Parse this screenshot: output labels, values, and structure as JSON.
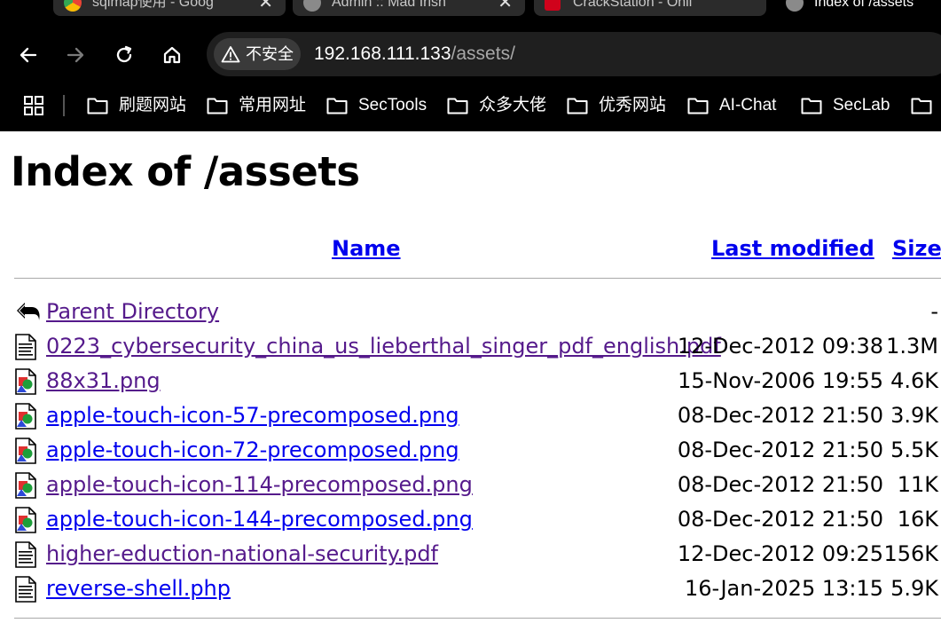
{
  "browser": {
    "tabs": [
      {
        "title": "sqlmap使用 - Goog"
      },
      {
        "title": "Admin :: Mad Irish"
      },
      {
        "title": "CrackStation - Onli"
      },
      {
        "title": "Index of /assets"
      }
    ],
    "security_label": "不安全",
    "url_host": "192.168.111.133",
    "url_path": "/assets/",
    "bookmarks": [
      {
        "label": "刷题网站"
      },
      {
        "label": "常用网址"
      },
      {
        "label": "SecTools"
      },
      {
        "label": "众多大佬"
      },
      {
        "label": "优秀网站"
      },
      {
        "label": "AI-Chat"
      },
      {
        "label": "SecLab"
      }
    ]
  },
  "page": {
    "title": "Index of /assets",
    "columns": {
      "name": "Name",
      "last_modified": "Last modified",
      "size": "Size"
    },
    "rows": [
      {
        "name": "Parent Directory",
        "date": "",
        "size": "-",
        "icon": "back-icon",
        "visited": true
      },
      {
        "name": "0223_cybersecurity_china_us_lieberthal_singer_pdf_english.pdf",
        "date": "12-Dec-2012 09:38",
        "size": "1.3M",
        "icon": "text-file-icon",
        "visited": true
      },
      {
        "name": "88x31.png",
        "date": "15-Nov-2006 19:55",
        "size": "4.6K",
        "icon": "image-file-icon",
        "visited": true
      },
      {
        "name": "apple-touch-icon-57-precomposed.png",
        "date": "08-Dec-2012 21:50",
        "size": "3.9K",
        "icon": "image-file-icon",
        "visited": false
      },
      {
        "name": "apple-touch-icon-72-precomposed.png",
        "date": "08-Dec-2012 21:50",
        "size": "5.5K",
        "icon": "image-file-icon",
        "visited": false
      },
      {
        "name": "apple-touch-icon-114-precomposed.png",
        "date": "08-Dec-2012 21:50",
        "size": "11K",
        "icon": "image-file-icon",
        "visited": true
      },
      {
        "name": "apple-touch-icon-144-precomposed.png",
        "date": "08-Dec-2012 21:50",
        "size": "16K",
        "icon": "image-file-icon",
        "visited": false
      },
      {
        "name": "higher-eduction-national-security.pdf",
        "date": "12-Dec-2012 09:25",
        "size": "156K",
        "icon": "text-file-icon",
        "visited": true
      },
      {
        "name": "reverse-shell.php",
        "date": "16-Jan-2025 13:15",
        "size": "5.9K",
        "icon": "text-file-icon",
        "visited": false
      }
    ]
  },
  "colors": {
    "link": "#0000ee",
    "visited_link": "#551a8b",
    "chrome_bg": "#000000",
    "omnibox_bg": "#1f1f1f"
  }
}
